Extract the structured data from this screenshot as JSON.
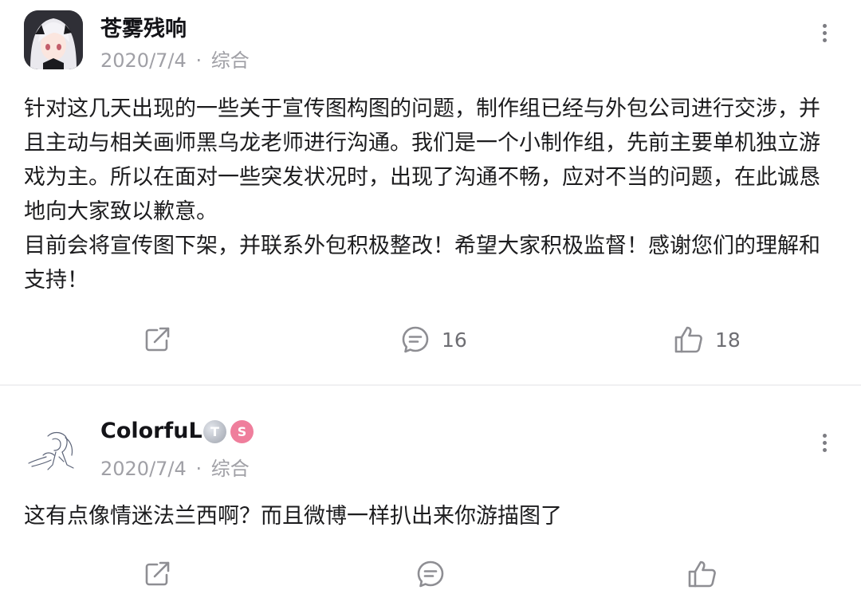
{
  "posts": [
    {
      "author": "苍雾残响",
      "date": "2020/7/4",
      "separator": "·",
      "category": "综合",
      "avatar_icon": "anime-character-avatar",
      "content": [
        "针对这几天出现的一些关于宣传图构图的问题，制作组已经与外包公司进行交涉，并且主动与相关画师黑乌龙老师进行沟通。我们是一个小制作组，先前主要单机独立游戏为主。所以在面对一些突发状况时，出现了沟通不畅，应对不当的问题，在此诚恳地向大家致以歉意。",
        "目前会将宣传图下架，并联系外包积极整改！希望大家积极监督！感谢您们的理解和支持！"
      ],
      "actions": {
        "share_count": "",
        "comment_count": "16",
        "like_count": "18"
      }
    },
    {
      "author": "ColorfuL",
      "date": "2020/7/4",
      "separator": "·",
      "category": "综合",
      "avatar_icon": "line-sketch-avatar",
      "badges": [
        {
          "icon": "level-t-badge-icon",
          "text": "T",
          "color": "#9ea3ad"
        },
        {
          "icon": "pink-s-badge-icon",
          "text": "S",
          "color": "#ef7e9c"
        }
      ],
      "content": [
        "这有点像情迷法兰西啊？而且微博一样扒出来你游描图了"
      ],
      "actions": {
        "share_count": "",
        "comment_count": "",
        "like_count": ""
      }
    }
  ],
  "colors": {
    "text": "#1c1c1e",
    "meta": "#a0a0a6",
    "icon": "#8e8e93",
    "divider": "#f0f0f2"
  }
}
